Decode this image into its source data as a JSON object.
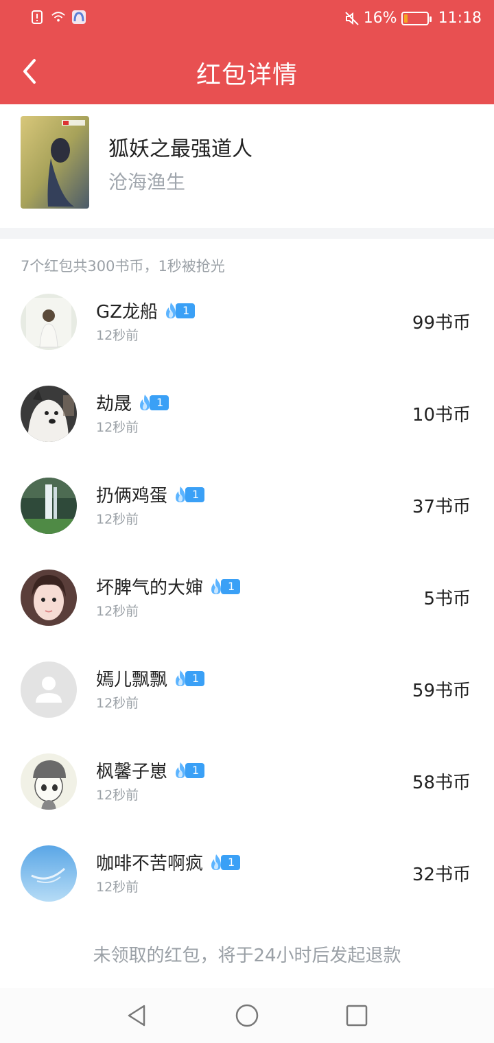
{
  "status": {
    "battery_text": "16%",
    "battery_level": 0.16,
    "time": "11:18"
  },
  "nav": {
    "title": "红包详情"
  },
  "book": {
    "title": "狐妖之最强道人",
    "author": "沧海渔生"
  },
  "summary": "7个红包共300书币，1秒被抢光",
  "entries": [
    {
      "name": "GZ龙船",
      "level": "1",
      "time": "12秒前",
      "amount": "99书币"
    },
    {
      "name": "劫晟",
      "level": "1",
      "time": "12秒前",
      "amount": "10书币"
    },
    {
      "name": "扔俩鸡蛋",
      "level": "1",
      "time": "12秒前",
      "amount": "37书币"
    },
    {
      "name": "坏脾气的大婶",
      "level": "1",
      "time": "12秒前",
      "amount": "5书币"
    },
    {
      "name": "嫣儿飘飘",
      "level": "1",
      "time": "12秒前",
      "amount": "59书币"
    },
    {
      "name": "枫馨子崽",
      "level": "1",
      "time": "12秒前",
      "amount": "58书币"
    },
    {
      "name": "咖啡不苦啊疯",
      "level": "1",
      "time": "12秒前",
      "amount": "32书币"
    }
  ],
  "footer_note": "未领取的红包，将于24小时后发起退款",
  "icons": {
    "back": "chevron-left-icon",
    "flame": "flame-icon",
    "nav_back": "triangle-back-icon",
    "nav_home": "circle-home-icon",
    "nav_recent": "square-recent-icon"
  },
  "colors": {
    "header": "#e85051",
    "badge": "#3aa0f6"
  }
}
